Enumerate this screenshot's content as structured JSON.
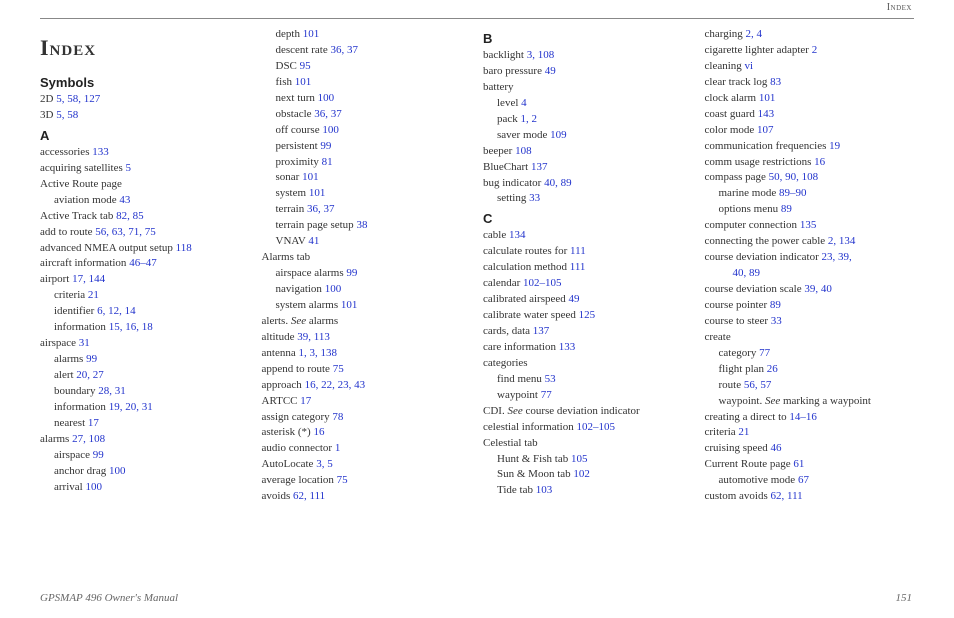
{
  "header_label": "Index",
  "title": "Index",
  "footer_left": "GPSMAP 496 Owner's Manual",
  "footer_right": "151",
  "columns": [
    {
      "blocks": [
        {
          "type": "title"
        },
        {
          "type": "section",
          "text": "Symbols"
        },
        {
          "type": "entry",
          "indent": 0,
          "text": "2D ",
          "pages": "5, 58, 127"
        },
        {
          "type": "entry",
          "indent": 0,
          "text": "3D ",
          "pages": "5, 58"
        },
        {
          "type": "section",
          "text": "A"
        },
        {
          "type": "entry",
          "indent": 0,
          "text": "accessories ",
          "pages": "133"
        },
        {
          "type": "entry",
          "indent": 0,
          "text": "acquiring satellites ",
          "pages": "5"
        },
        {
          "type": "entry",
          "indent": 0,
          "text": "Active Route page"
        },
        {
          "type": "entry",
          "indent": 1,
          "text": "aviation mode ",
          "pages": "43"
        },
        {
          "type": "entry",
          "indent": 0,
          "text": "Active Track tab ",
          "pages": "82, 85"
        },
        {
          "type": "entry",
          "indent": 0,
          "text": "add to route ",
          "pages": "56, 63, 71, 75"
        },
        {
          "type": "entry",
          "indent": 0,
          "text": "advanced NMEA output setup ",
          "pages": "118"
        },
        {
          "type": "entry",
          "indent": 0,
          "text": "aircraft information ",
          "pages": "46–47"
        },
        {
          "type": "entry",
          "indent": 0,
          "text": "airport ",
          "pages": "17, 144"
        },
        {
          "type": "entry",
          "indent": 1,
          "text": "criteria ",
          "pages": "21"
        },
        {
          "type": "entry",
          "indent": 1,
          "text": "identifier ",
          "pages": "6, 12, 14"
        },
        {
          "type": "entry",
          "indent": 1,
          "text": "information ",
          "pages": "15, 16, 18"
        },
        {
          "type": "entry",
          "indent": 0,
          "text": "airspace ",
          "pages": "31"
        },
        {
          "type": "entry",
          "indent": 1,
          "text": "alarms ",
          "pages": "99"
        },
        {
          "type": "entry",
          "indent": 1,
          "text": "alert ",
          "pages": "20, 27"
        },
        {
          "type": "entry",
          "indent": 1,
          "text": "boundary ",
          "pages": "28, 31"
        },
        {
          "type": "entry",
          "indent": 1,
          "text": "information ",
          "pages": "19, 20, 31"
        },
        {
          "type": "entry",
          "indent": 1,
          "text": "nearest ",
          "pages": "17"
        },
        {
          "type": "entry",
          "indent": 0,
          "text": "alarms ",
          "pages": "27, 108"
        },
        {
          "type": "entry",
          "indent": 1,
          "text": "airspace ",
          "pages": "99"
        },
        {
          "type": "entry",
          "indent": 1,
          "text": "anchor drag ",
          "pages": "100"
        },
        {
          "type": "entry",
          "indent": 1,
          "text": "arrival ",
          "pages": "100"
        }
      ]
    },
    {
      "blocks": [
        {
          "type": "entry",
          "indent": 1,
          "text": "depth ",
          "pages": "101"
        },
        {
          "type": "entry",
          "indent": 1,
          "text": "descent rate ",
          "pages": "36, 37"
        },
        {
          "type": "entry",
          "indent": 1,
          "text": "DSC ",
          "pages": "95"
        },
        {
          "type": "entry",
          "indent": 1,
          "text": "fish ",
          "pages": "101"
        },
        {
          "type": "entry",
          "indent": 1,
          "text": "next turn ",
          "pages": "100"
        },
        {
          "type": "entry",
          "indent": 1,
          "text": "obstacle ",
          "pages": "36, 37"
        },
        {
          "type": "entry",
          "indent": 1,
          "text": "off course ",
          "pages": "100"
        },
        {
          "type": "entry",
          "indent": 1,
          "text": "persistent ",
          "pages": "99"
        },
        {
          "type": "entry",
          "indent": 1,
          "text": "proximity ",
          "pages": "81"
        },
        {
          "type": "entry",
          "indent": 1,
          "text": "sonar ",
          "pages": "101"
        },
        {
          "type": "entry",
          "indent": 1,
          "text": "system ",
          "pages": "101"
        },
        {
          "type": "entry",
          "indent": 1,
          "text": "terrain ",
          "pages": "36, 37"
        },
        {
          "type": "entry",
          "indent": 1,
          "text": "terrain page setup ",
          "pages": "38"
        },
        {
          "type": "entry",
          "indent": 1,
          "text": "VNAV ",
          "pages": "41"
        },
        {
          "type": "entry",
          "indent": 0,
          "text": "Alarms tab"
        },
        {
          "type": "entry",
          "indent": 1,
          "text": "airspace alarms ",
          "pages": "99"
        },
        {
          "type": "entry",
          "indent": 1,
          "text": "navigation ",
          "pages": "100"
        },
        {
          "type": "entry",
          "indent": 1,
          "text": "system alarms ",
          "pages": "101"
        },
        {
          "type": "entry",
          "indent": 0,
          "text": "alerts. ",
          "see": "See",
          "after": " alarms"
        },
        {
          "type": "entry",
          "indent": 0,
          "text": "altitude ",
          "pages": "39, 113"
        },
        {
          "type": "entry",
          "indent": 0,
          "text": "antenna ",
          "pages": "1, 3, 138"
        },
        {
          "type": "entry",
          "indent": 0,
          "text": "append to route ",
          "pages": "75"
        },
        {
          "type": "entry",
          "indent": 0,
          "text": "approach ",
          "pages": "16, 22, 23, 43"
        },
        {
          "type": "entry",
          "indent": 0,
          "text": "ARTCC ",
          "pages": "17"
        },
        {
          "type": "entry",
          "indent": 0,
          "text": "assign category ",
          "pages": "78"
        },
        {
          "type": "entry",
          "indent": 0,
          "text": "asterisk (*) ",
          "pages": "16"
        },
        {
          "type": "entry",
          "indent": 0,
          "text": "audio connector ",
          "pages": "1"
        },
        {
          "type": "entry",
          "indent": 0,
          "text": "AutoLocate ",
          "pages": "3, 5"
        },
        {
          "type": "entry",
          "indent": 0,
          "text": "average location ",
          "pages": "75"
        },
        {
          "type": "entry",
          "indent": 0,
          "text": "avoids ",
          "pages": "62, 111"
        }
      ]
    },
    {
      "blocks": [
        {
          "type": "section",
          "text": "B"
        },
        {
          "type": "entry",
          "indent": 0,
          "text": "backlight ",
          "pages": "3, 108"
        },
        {
          "type": "entry",
          "indent": 0,
          "text": "baro pressure ",
          "pages": "49"
        },
        {
          "type": "entry",
          "indent": 0,
          "text": "battery"
        },
        {
          "type": "entry",
          "indent": 1,
          "text": "level ",
          "pages": "4"
        },
        {
          "type": "entry",
          "indent": 1,
          "text": "pack ",
          "pages": "1, 2"
        },
        {
          "type": "entry",
          "indent": 1,
          "text": "saver mode ",
          "pages": "109"
        },
        {
          "type": "entry",
          "indent": 0,
          "text": "beeper ",
          "pages": "108"
        },
        {
          "type": "entry",
          "indent": 0,
          "text": "BlueChart ",
          "pages": "137"
        },
        {
          "type": "entry",
          "indent": 0,
          "text": "bug indicator ",
          "pages": "40, 89"
        },
        {
          "type": "entry",
          "indent": 1,
          "text": "setting ",
          "pages": "33"
        },
        {
          "type": "section",
          "text": "C"
        },
        {
          "type": "entry",
          "indent": 0,
          "text": "cable ",
          "pages": "134"
        },
        {
          "type": "entry",
          "indent": 0,
          "text": "calculate routes for ",
          "pages": "111"
        },
        {
          "type": "entry",
          "indent": 0,
          "text": "calculation method ",
          "pages": "111"
        },
        {
          "type": "entry",
          "indent": 0,
          "text": "calendar ",
          "pages": "102–105"
        },
        {
          "type": "entry",
          "indent": 0,
          "text": "calibrated airspeed ",
          "pages": "49"
        },
        {
          "type": "entry",
          "indent": 0,
          "text": "calibrate water speed ",
          "pages": "125"
        },
        {
          "type": "entry",
          "indent": 0,
          "text": "cards, data ",
          "pages": "137"
        },
        {
          "type": "entry",
          "indent": 0,
          "text": "care information ",
          "pages": "133"
        },
        {
          "type": "entry",
          "indent": 0,
          "text": "categories"
        },
        {
          "type": "entry",
          "indent": 1,
          "text": "find menu ",
          "pages": "53"
        },
        {
          "type": "entry",
          "indent": 1,
          "text": "waypoint ",
          "pages": "77"
        },
        {
          "type": "entry",
          "indent": 0,
          "text": "CDI. ",
          "see": "See",
          "after": " course deviation indicator"
        },
        {
          "type": "entry",
          "indent": 0,
          "text": "celestial information ",
          "pages": "102–105"
        },
        {
          "type": "entry",
          "indent": 0,
          "text": "Celestial tab"
        },
        {
          "type": "entry",
          "indent": 1,
          "text": "Hunt & Fish tab ",
          "pages": "105"
        },
        {
          "type": "entry",
          "indent": 1,
          "text": "Sun & Moon tab ",
          "pages": "102"
        },
        {
          "type": "entry",
          "indent": 1,
          "text": "Tide tab ",
          "pages": "103"
        }
      ]
    },
    {
      "blocks": [
        {
          "type": "entry",
          "indent": 0,
          "text": "charging ",
          "pages": "2, 4"
        },
        {
          "type": "entry",
          "indent": 0,
          "text": "cigarette lighter adapter ",
          "pages": "2"
        },
        {
          "type": "entry",
          "indent": 0,
          "text": "cleaning ",
          "pages": "vi"
        },
        {
          "type": "entry",
          "indent": 0,
          "text": "clear track log ",
          "pages": "83"
        },
        {
          "type": "entry",
          "indent": 0,
          "text": "clock alarm ",
          "pages": "101"
        },
        {
          "type": "entry",
          "indent": 0,
          "text": "coast guard ",
          "pages": "143"
        },
        {
          "type": "entry",
          "indent": 0,
          "text": "color mode ",
          "pages": "107"
        },
        {
          "type": "entry",
          "indent": 0,
          "text": "communication frequencies ",
          "pages": "19"
        },
        {
          "type": "entry",
          "indent": 0,
          "text": "comm usage restrictions ",
          "pages": "16"
        },
        {
          "type": "entry",
          "indent": 0,
          "text": "compass page ",
          "pages": "50, 90, 108"
        },
        {
          "type": "entry",
          "indent": 1,
          "text": "marine mode ",
          "pages": "89–90"
        },
        {
          "type": "entry",
          "indent": 1,
          "text": "options menu ",
          "pages": "89"
        },
        {
          "type": "entry",
          "indent": 0,
          "text": "computer connection ",
          "pages": "135"
        },
        {
          "type": "entry",
          "indent": 0,
          "text": "connecting the power cable ",
          "pages": "2, 134"
        },
        {
          "type": "entry",
          "indent": 0,
          "text": "course deviation indicator ",
          "pages": "23, 39,"
        },
        {
          "type": "entry",
          "indent": 2,
          "text": "",
          "pages": "40, 89"
        },
        {
          "type": "entry",
          "indent": 0,
          "text": "course deviation scale ",
          "pages": "39, 40"
        },
        {
          "type": "entry",
          "indent": 0,
          "text": "course pointer ",
          "pages": "89"
        },
        {
          "type": "entry",
          "indent": 0,
          "text": "course to steer ",
          "pages": "33"
        },
        {
          "type": "entry",
          "indent": 0,
          "text": "create"
        },
        {
          "type": "entry",
          "indent": 1,
          "text": "category ",
          "pages": "77"
        },
        {
          "type": "entry",
          "indent": 1,
          "text": "flight plan ",
          "pages": "26"
        },
        {
          "type": "entry",
          "indent": 1,
          "text": "route ",
          "pages": "56, 57"
        },
        {
          "type": "entry",
          "indent": 1,
          "text": "waypoint. ",
          "see": "See",
          "after": " marking a waypoint"
        },
        {
          "type": "entry",
          "indent": 0,
          "text": "creating a direct to ",
          "pages": "14–16"
        },
        {
          "type": "entry",
          "indent": 0,
          "text": "criteria ",
          "pages": "21"
        },
        {
          "type": "entry",
          "indent": 0,
          "text": "cruising speed ",
          "pages": "46"
        },
        {
          "type": "entry",
          "indent": 0,
          "text": "Current Route page ",
          "pages": "61"
        },
        {
          "type": "entry",
          "indent": 1,
          "text": "automotive mode ",
          "pages": "67"
        },
        {
          "type": "entry",
          "indent": 0,
          "text": "custom avoids ",
          "pages": "62, 111"
        }
      ]
    }
  ]
}
